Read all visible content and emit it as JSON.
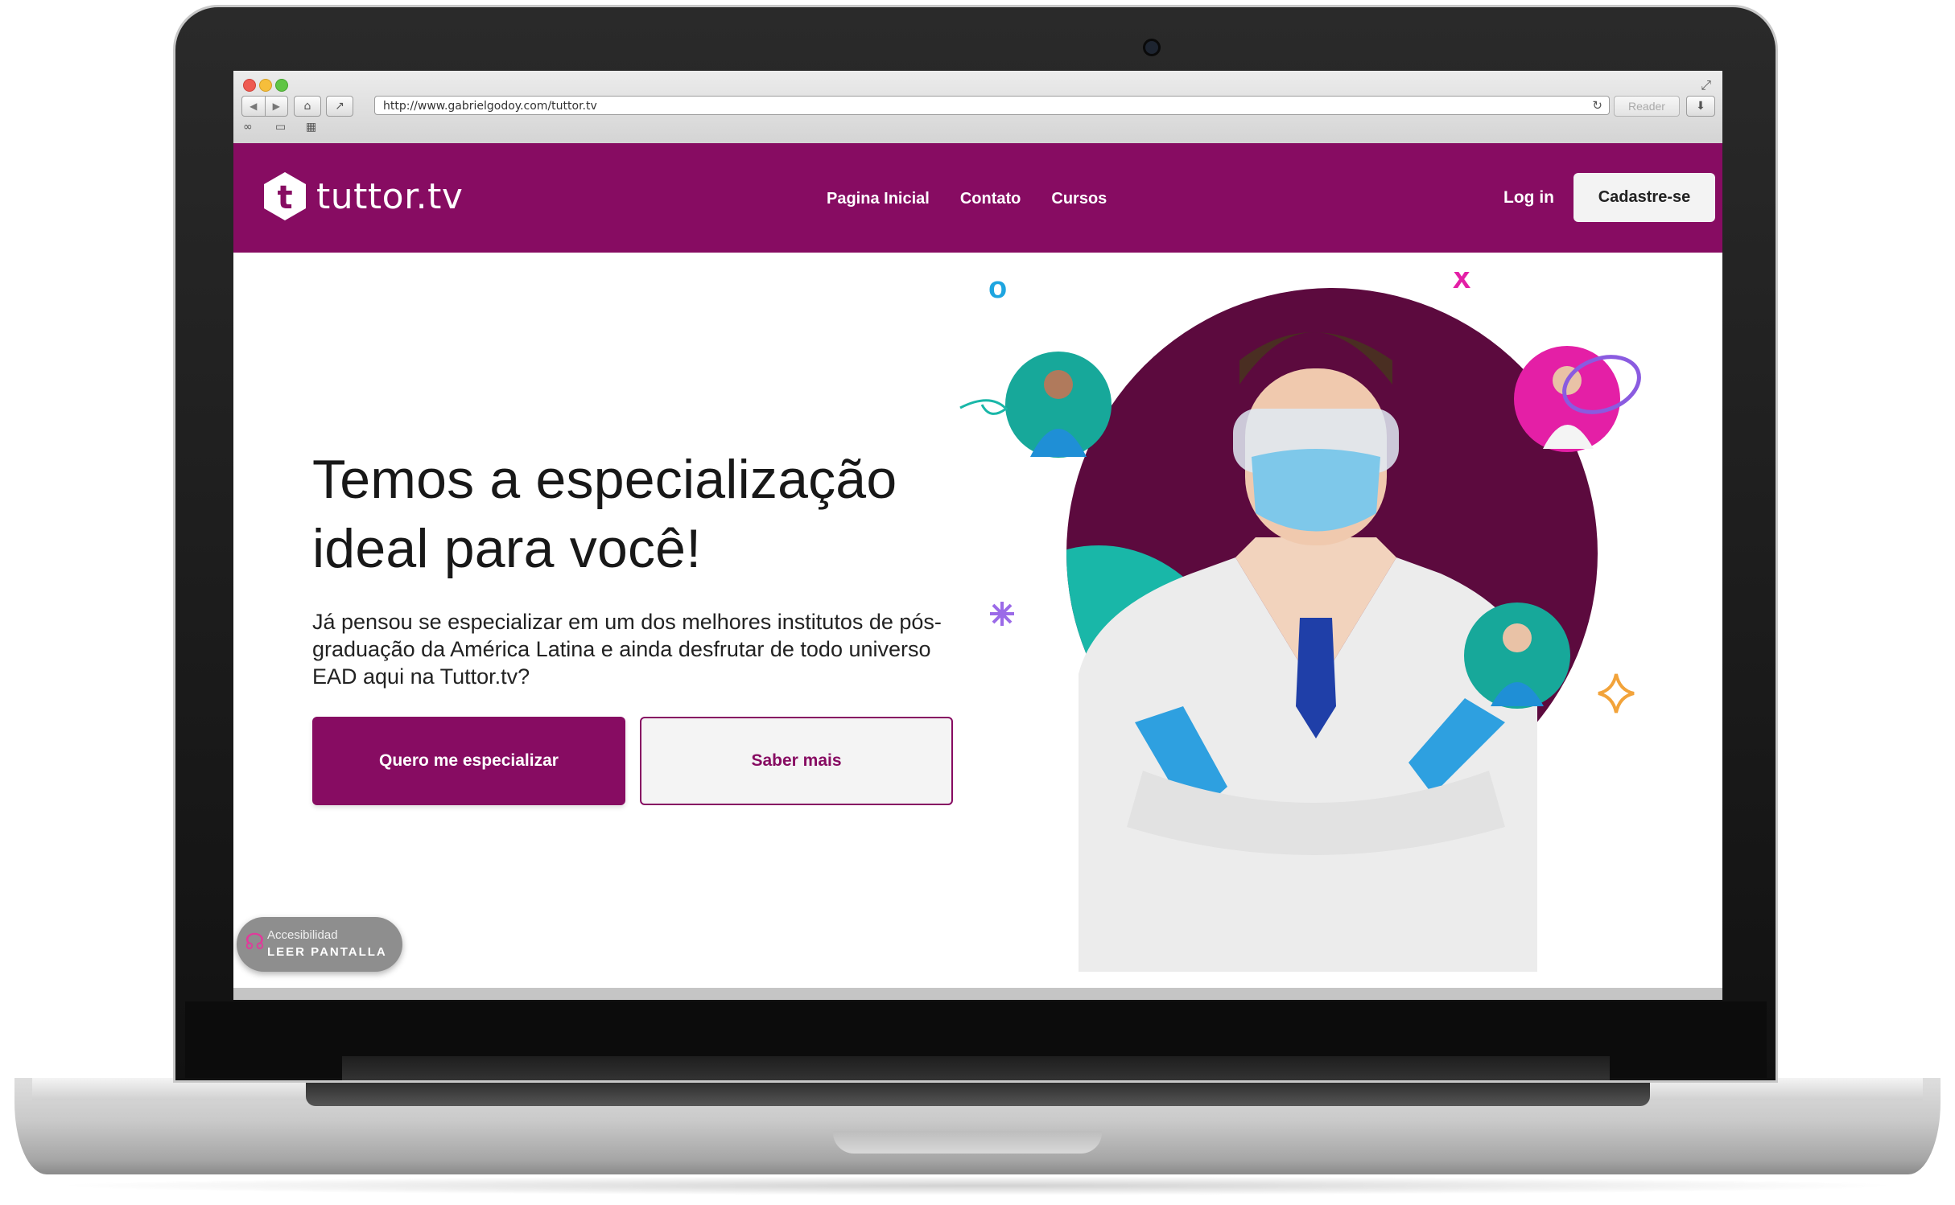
{
  "browser": {
    "url": "http://www.gabrielgodoy.com/tuttor.tv",
    "reader_label": "Reader"
  },
  "site": {
    "logo_letter": "t",
    "logo_text": "tuttor.tv",
    "nav": [
      "Pagina Inicial",
      "Contato",
      "Cursos"
    ],
    "login": "Log in",
    "signup": "Cadastre-se",
    "brand_color": "#870c62",
    "accent_teal": "#1bbfae",
    "accent_pink": "#e41fa6"
  },
  "hero": {
    "title_line1": "Temos a especialização",
    "title_line2": "ideal para você!",
    "description": "Já pensou se especializar em um dos melhores institutos de pós-graduação da América Latina e ainda desfrutar de todo universo EAD aqui na Tuttor.tv?",
    "primary_button": "Quero me especializar",
    "secondary_button": "Saber mais",
    "decor_o": "o",
    "decor_x": "x"
  },
  "accessibility": {
    "label_small": "Accesibilidad",
    "label_big": "LEER PANTALLA"
  }
}
